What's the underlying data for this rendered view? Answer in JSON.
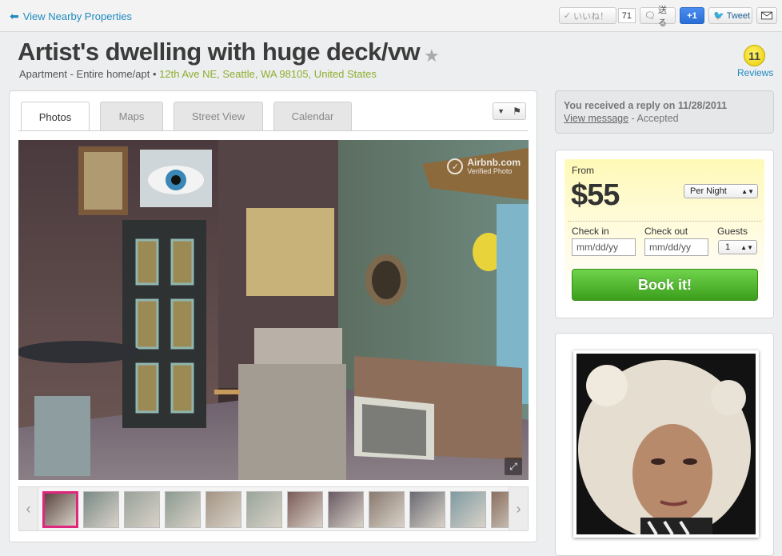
{
  "topbar": {
    "back_label": "View Nearby Properties",
    "like_label": "いいね！",
    "like_count": "71",
    "send_label": "送る",
    "plus_one_label": "+1",
    "tweet_label": "Tweet"
  },
  "listing": {
    "title": "Artist's dwelling with huge deck/vw",
    "room_type": "Apartment - Entire home/apt",
    "separator": "•",
    "address": "12th Ave NE, Seattle, WA 98105, United States",
    "review_count": "11",
    "reviews_label": "Reviews"
  },
  "tabs": [
    {
      "label": "Photos"
    },
    {
      "label": "Maps"
    },
    {
      "label": "Street View"
    },
    {
      "label": "Calendar"
    }
  ],
  "photo": {
    "watermark_brand": "Airbnb.com",
    "watermark_sub": "Verified Photo",
    "thumbnail_count": 12,
    "selected_thumbnail": 1
  },
  "reply": {
    "text": "You received a reply on 11/28/2011",
    "link": "View message",
    "status": " - Accepted"
  },
  "booking": {
    "from_label": "From",
    "price": "$55",
    "period": "Per Night",
    "checkin_label": "Check in",
    "checkout_label": "Check out",
    "guests_label": "Guests",
    "checkin_placeholder": "mm/dd/yy",
    "checkout_placeholder": "mm/dd/yy",
    "guests_value": "1",
    "book_label": "Book it!"
  },
  "colors": {
    "link": "#1f8ac0",
    "address": "#8fae2f",
    "book_button": "#4cb02a",
    "selected_thumb": "#e0277e"
  }
}
